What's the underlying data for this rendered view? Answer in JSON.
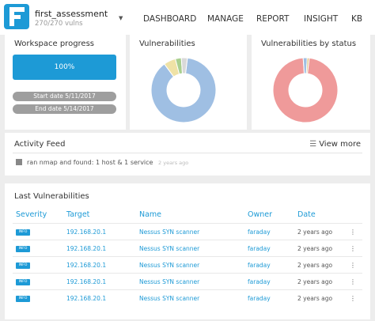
{
  "workspace": {
    "name": "first_assessment",
    "subtitle": "270/270 vulns"
  },
  "nav": [
    "DASHBOARD",
    "MANAGE",
    "REPORT",
    "INSIGHT",
    "KB"
  ],
  "progress_card": {
    "title": "Workspace progress",
    "progress_label": "100%",
    "progress": 1.0,
    "start_date": "Start date 5/11/2017",
    "end_date": "End date 5/14/2017"
  },
  "vuln_card": {
    "title": "Vulnerabilities"
  },
  "status_card": {
    "title": "Vulnerabilities by status"
  },
  "chart_data": [
    {
      "type": "pie",
      "slices": [
        {
          "value": 88,
          "color": "#9fbfe3"
        },
        {
          "value": 6,
          "color": "#efe2a6"
        },
        {
          "value": 3,
          "color": "#a9cf8f"
        },
        {
          "value": 3,
          "color": "#d9d9d9"
        }
      ]
    },
    {
      "type": "pie",
      "slices": [
        {
          "value": 97,
          "color": "#ef9a9a"
        },
        {
          "value": 2,
          "color": "#9fbfe3"
        },
        {
          "value": 1,
          "color": "#e0c07a"
        }
      ]
    }
  ],
  "activity": {
    "title": "Activity Feed",
    "view_more": "View more",
    "items": [
      {
        "text": "ran nmap and found: 1 host & 1 service",
        "time": "2 years ago"
      }
    ]
  },
  "last_vulns": {
    "title": "Last Vulnerabilities",
    "columns": [
      "Severity",
      "Target",
      "Name",
      "Owner",
      "Date"
    ],
    "rows": [
      {
        "severity": "INFO",
        "target": "192.168.20.1",
        "name": "Nessus SYN scanner",
        "owner": "faraday",
        "date": "2 years ago"
      },
      {
        "severity": "INFO",
        "target": "192.168.20.1",
        "name": "Nessus SYN scanner",
        "owner": "faraday",
        "date": "2 years ago"
      },
      {
        "severity": "INFO",
        "target": "192.168.20.1",
        "name": "Nessus SYN scanner",
        "owner": "faraday",
        "date": "2 years ago"
      },
      {
        "severity": "INFO",
        "target": "192.168.20.1",
        "name": "Nessus SYN scanner",
        "owner": "faraday",
        "date": "2 years ago"
      },
      {
        "severity": "INFO",
        "target": "192.168.20.1",
        "name": "Nessus SYN scanner",
        "owner": "faraday",
        "date": "2 years ago"
      }
    ]
  },
  "colors": {
    "accent": "#1d9ad6",
    "background": "#ededed"
  }
}
